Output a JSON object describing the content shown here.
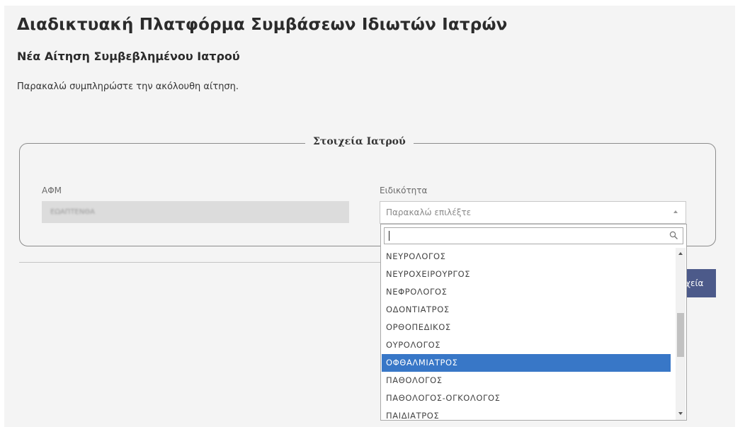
{
  "header": {
    "title": "Διαδικτυακή Πλατφόρμα Συμβάσεων Ιδιωτών Ιατρών",
    "subtitle": "Νέα Αίτηση Συμβεβλημένου Ιατρού",
    "instructions": "Παρακαλώ συμπληρώστε την ακόλουθη αίτηση."
  },
  "form": {
    "legend": "Στοιχεία Ιατρού",
    "afm": {
      "label": "ΑΦΜ",
      "value": "ΕΩΑΠΤΕΝΘΑ"
    },
    "specialty": {
      "label": "Ειδικότητα",
      "placeholder": "Παρακαλώ επιλέξτε",
      "search_value": "",
      "options": [
        "ΝΕΥΡΟΛΟΓΟΣ",
        "ΝΕΥΡΟΧΕΙΡΟΥΡΓΟΣ",
        "ΝΕΦΡΟΛΟΓΟΣ",
        "ΟΔΟΝΤΙΑΤΡΟΣ",
        "ΟΡΘΟΠΕΔΙΚΟΣ",
        "ΟΥΡΟΛΟΓΟΣ",
        "ΟΦΘΑΛΜΙΑΤΡΟΣ",
        "ΠΑΘΟΛΟΓΟΣ",
        "ΠΑΘΟΛΟΓΟΣ-ΟΓΚΟΛΟΓΟΣ",
        "ΠΑΙΔΙΑΤΡΟΣ"
      ],
      "highlighted_index": 6
    }
  },
  "actions": {
    "next_label": "ιχεία"
  },
  "colors": {
    "highlight": "#3877c7",
    "button": "#4c5a8a",
    "page_background": "#f4f4f4"
  },
  "icons": {
    "search": "search-icon",
    "select_arrow": "chevron-up-icon"
  }
}
